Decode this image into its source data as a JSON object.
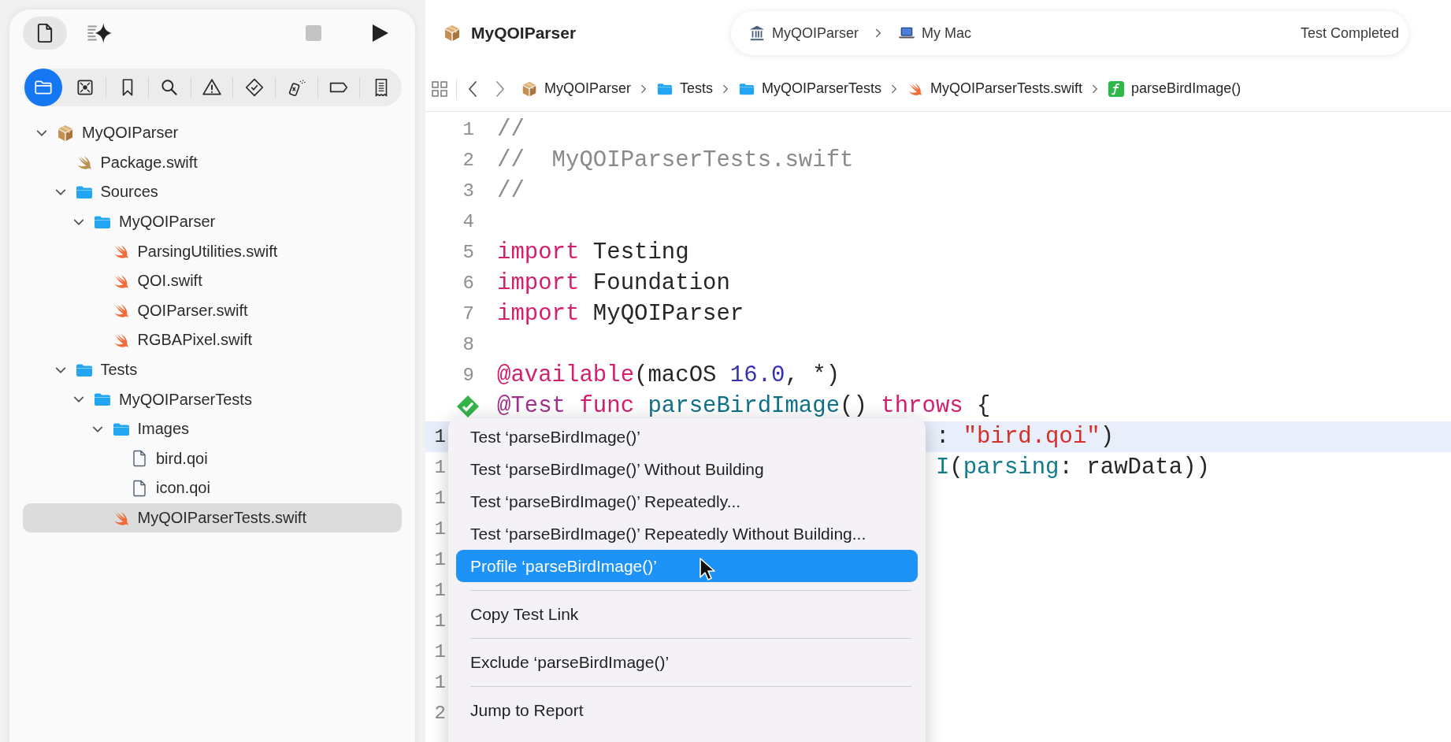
{
  "sidebar": {
    "modes": [
      {
        "kind": "document",
        "selected": true
      },
      {
        "kind": "assistant",
        "selected": false
      }
    ],
    "navigator_tabs": [
      {
        "kind": "folder",
        "selected": true
      },
      {
        "kind": "source-control",
        "selected": false
      },
      {
        "kind": "bookmark",
        "selected": false
      },
      {
        "kind": "search",
        "selected": false
      },
      {
        "kind": "warning",
        "selected": false
      },
      {
        "kind": "test",
        "selected": false
      },
      {
        "kind": "debug",
        "selected": false
      },
      {
        "kind": "tag",
        "selected": false
      },
      {
        "kind": "report",
        "selected": false
      }
    ],
    "tree": [
      {
        "kind": "package",
        "label": "MyQOIParser",
        "expanded": true,
        "selected": false,
        "children": [
          {
            "kind": "manifest",
            "label": "Package.swift",
            "selected": false
          },
          {
            "kind": "folder",
            "label": "Sources",
            "expanded": true,
            "selected": false,
            "children": [
              {
                "kind": "folder",
                "label": "MyQOIParser",
                "expanded": true,
                "selected": false,
                "children": [
                  {
                    "kind": "swift",
                    "label": "ParsingUtilities.swift",
                    "selected": false
                  },
                  {
                    "kind": "swift",
                    "label": "QOI.swift",
                    "selected": false
                  },
                  {
                    "kind": "swift",
                    "label": "QOIParser.swift",
                    "selected": false
                  },
                  {
                    "kind": "swift",
                    "label": "RGBAPixel.swift",
                    "selected": false
                  }
                ]
              }
            ]
          },
          {
            "kind": "folder",
            "label": "Tests",
            "expanded": true,
            "selected": false,
            "children": [
              {
                "kind": "folder",
                "label": "MyQOIParserTests",
                "expanded": true,
                "selected": false,
                "children": [
                  {
                    "kind": "folder",
                    "label": "Images",
                    "expanded": true,
                    "selected": false,
                    "children": [
                      {
                        "kind": "file",
                        "label": "bird.qoi",
                        "selected": false
                      },
                      {
                        "kind": "file",
                        "label": "icon.qoi",
                        "selected": false
                      }
                    ]
                  },
                  {
                    "kind": "swift",
                    "label": "MyQOIParserTests.swift",
                    "selected": true
                  }
                ]
              }
            ]
          }
        ]
      }
    ]
  },
  "editor": {
    "title": "MyQOIParser",
    "scheme": [
      {
        "kind": "project",
        "label": "MyQOIParser"
      },
      {
        "kind": "device",
        "label": "My Mac"
      }
    ],
    "status": "Test Completed",
    "breadcrumbs": [
      {
        "kind": "package",
        "label": "MyQOIParser"
      },
      {
        "kind": "folder",
        "label": "Tests"
      },
      {
        "kind": "folder",
        "label": "MyQOIParserTests"
      },
      {
        "kind": "swift",
        "label": "MyQOIParserTests.swift"
      },
      {
        "kind": "function",
        "label": "parseBirdImage()"
      }
    ],
    "lines": [
      {
        "kind": "code",
        "number": "1",
        "current": false,
        "segments": [
          {
            "text": "//",
            "kind": "comment"
          }
        ]
      },
      {
        "kind": "code",
        "number": "2",
        "current": false,
        "segments": [
          {
            "text": "//  MyQOIParserTests.swift",
            "kind": "comment"
          }
        ]
      },
      {
        "kind": "code",
        "number": "3",
        "current": false,
        "segments": [
          {
            "text": "//",
            "kind": "comment"
          }
        ]
      },
      {
        "kind": "code",
        "number": "4",
        "current": false
      },
      {
        "kind": "code",
        "number": "5",
        "current": false,
        "segments": [
          {
            "text": "import",
            "kind": "keyword"
          },
          {
            "text": " Testing",
            "kind": "plain"
          }
        ]
      },
      {
        "kind": "code",
        "number": "6",
        "current": false,
        "segments": [
          {
            "text": "import",
            "kind": "keyword"
          },
          {
            "text": " Foundation",
            "kind": "plain"
          }
        ]
      },
      {
        "kind": "code",
        "number": "7",
        "current": false,
        "segments": [
          {
            "text": "import",
            "kind": "keyword"
          },
          {
            "text": " MyQOIParser",
            "kind": "plain"
          }
        ]
      },
      {
        "kind": "code",
        "number": "8",
        "current": false
      },
      {
        "kind": "code",
        "number": "9",
        "current": false,
        "segments": [
          {
            "text": "@available",
            "kind": "keyword"
          },
          {
            "text": "(macOS ",
            "kind": "plain"
          },
          {
            "text": "16.0",
            "kind": "number"
          },
          {
            "text": ", *)",
            "kind": "plain"
          }
        ]
      },
      {
        "kind": "test",
        "current": false,
        "segments": [
          {
            "text": "@Test",
            "kind": "attribute"
          },
          {
            "text": " func",
            "kind": "keyword"
          },
          {
            "text": " parseBirdImage",
            "kind": "function"
          },
          {
            "text": "() ",
            "kind": "plain"
          },
          {
            "text": "throws",
            "kind": "keyword"
          },
          {
            "text": " {",
            "kind": "plain"
          }
        ]
      },
      {
        "kind": "fragment",
        "number": "1",
        "current": true,
        "segments": [
          {
            "text": ": ",
            "kind": "plain"
          },
          {
            "text": "\"bird.qoi\"",
            "kind": "string"
          },
          {
            "text": ")",
            "kind": "plain"
          }
        ]
      },
      {
        "kind": "fragment",
        "number": "1",
        "current": false,
        "segments": [
          {
            "text": "I",
            "kind": "type"
          },
          {
            "text": "(",
            "kind": "plain"
          },
          {
            "text": "parsing",
            "kind": "type"
          },
          {
            "text": ": rawData))",
            "kind": "plain"
          }
        ]
      },
      {
        "kind": "fragment",
        "number": "1",
        "current": false
      },
      {
        "kind": "fragment",
        "number": "1",
        "current": false
      },
      {
        "kind": "fragment",
        "number": "1",
        "current": false
      },
      {
        "kind": "fragment",
        "number": "1",
        "current": false
      },
      {
        "kind": "fragment",
        "number": "1",
        "current": false
      },
      {
        "kind": "fragment",
        "number": "1",
        "current": false
      },
      {
        "kind": "fragment",
        "number": "1",
        "current": false
      },
      {
        "kind": "fragment",
        "number": "2",
        "current": false
      }
    ],
    "context_menu": {
      "groups": [
        [
          {
            "label": "Test ‘parseBirdImage()’",
            "selected": false
          },
          {
            "label": "Test ‘parseBirdImage()’ Without Building",
            "selected": false
          },
          {
            "label": "Test ‘parseBirdImage()’ Repeatedly...",
            "selected": false
          },
          {
            "label": "Test ‘parseBirdImage()’ Repeatedly Without Building...",
            "selected": false
          },
          {
            "label": "Profile ‘parseBirdImage()’",
            "selected": true
          }
        ],
        [
          {
            "label": "Copy Test Link",
            "selected": false
          }
        ],
        [
          {
            "label": "Exclude ‘parseBirdImage()’",
            "selected": false
          }
        ],
        [
          {
            "label": "Jump to Report",
            "selected": false
          }
        ]
      ]
    }
  }
}
